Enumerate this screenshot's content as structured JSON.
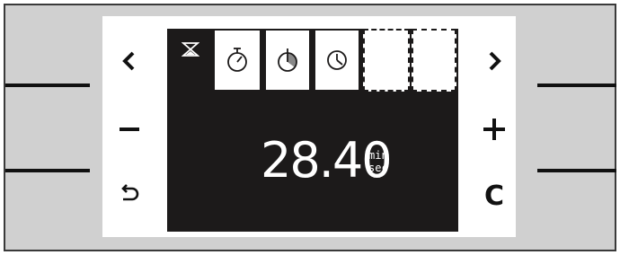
{
  "controls": {
    "left_top": "chevron-left-icon",
    "left_middle": "minus-icon",
    "left_bottom": "back-icon",
    "right_top": "chevron-right-icon",
    "right_middle": "plus-icon",
    "right_bottom_label": "C"
  },
  "tabs": [
    {
      "icon": "hourglass-icon",
      "state": "selected"
    },
    {
      "icon": "stopwatch-icon",
      "state": "available"
    },
    {
      "icon": "half-timer-icon",
      "state": "available"
    },
    {
      "icon": "clock-icon",
      "state": "available"
    },
    {
      "icon": "empty-slot",
      "state": "empty"
    },
    {
      "icon": "empty-slot",
      "state": "empty"
    }
  ],
  "display": {
    "time_value": "28.40",
    "unit_top": "min",
    "unit_bottom": "sec"
  },
  "colors": {
    "screen": "#1c1a1a",
    "frame": "#d0d0d0",
    "text_on_screen": "#ffffff"
  }
}
